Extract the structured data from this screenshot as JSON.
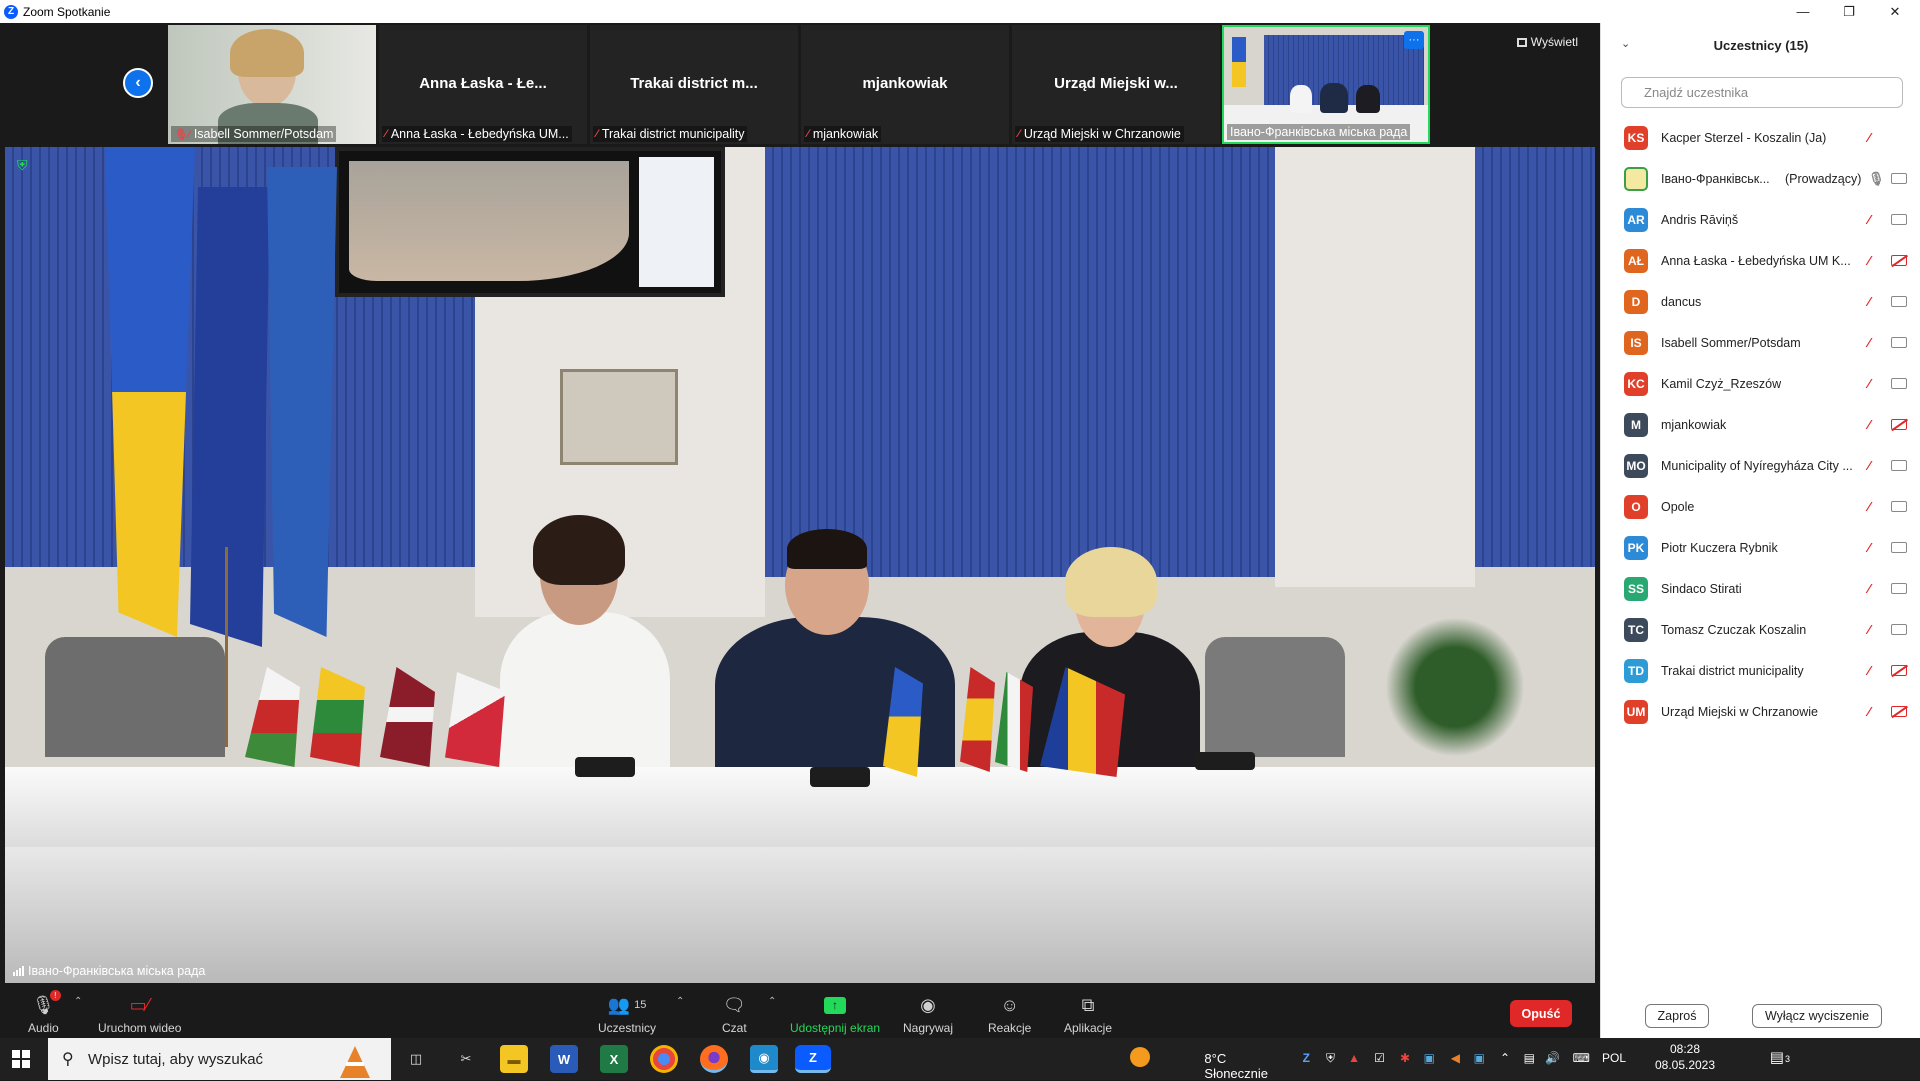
{
  "window": {
    "title": "Zoom Spotkanie"
  },
  "strip": {
    "view_label": "Wyświetl",
    "tiles": [
      {
        "name": "",
        "label": "Isabell Sommer/Potsdam",
        "video": true
      },
      {
        "name": "Anna Łaska - Łe...",
        "label": "Anna Łaska - Łebedyńska UM...",
        "video": false
      },
      {
        "name": "Trakai district m...",
        "label": "Trakai district municipality",
        "video": false
      },
      {
        "name": "mjankowiak",
        "label": "mjankowiak",
        "video": false
      },
      {
        "name": "Urząd Miejski w...",
        "label": "Urząd Miejski w Chrzanowie",
        "video": false
      },
      {
        "name": "",
        "label": "Івано-Франківська міська рада",
        "video": true
      }
    ],
    "more_label": "···"
  },
  "main": {
    "speaker_label": "Івано-Франківська міська рада"
  },
  "toolbar": {
    "audio": "Audio",
    "video": "Uruchom wideo",
    "participants": "Uczestnicy",
    "participants_count": "15",
    "chat": "Czat",
    "share": "Udostępnij ekran",
    "record": "Nagrywaj",
    "reactions": "Reakcje",
    "apps": "Aplikacje",
    "leave": "Opuść",
    "audio_badge": "!"
  },
  "panel": {
    "title": "Uczestnicy (15)",
    "search_placeholder": "Znajdź uczestnika",
    "participants": [
      {
        "initials": "KS",
        "name": "Kacper Sterzel - Koszalin (Ja)",
        "role": "",
        "color": "#e0402a",
        "mic": "off",
        "cam": "none"
      },
      {
        "initials": "",
        "name": "Івано-Франківськ...",
        "role": "(Prowadzący)",
        "color": "#3b9e4a",
        "mic": "on",
        "cam": "on"
      },
      {
        "initials": "AR",
        "name": "Andris Rāviņš",
        "role": "",
        "color": "#2d8ad6",
        "mic": "off",
        "cam": "on"
      },
      {
        "initials": "AŁ",
        "name": "Anna Łaska - Łebedyńska UM K...",
        "role": "",
        "color": "#e0651f",
        "mic": "off",
        "cam": "off"
      },
      {
        "initials": "D",
        "name": "dancus",
        "role": "",
        "color": "#e0651f",
        "mic": "off",
        "cam": "on"
      },
      {
        "initials": "IS",
        "name": "Isabell Sommer/Potsdam",
        "role": "",
        "color": "#e0651f",
        "mic": "off",
        "cam": "on"
      },
      {
        "initials": "KC",
        "name": "Kamil Czyż_Rzeszów",
        "role": "",
        "color": "#e0402a",
        "mic": "off",
        "cam": "on"
      },
      {
        "initials": "M",
        "name": "mjankowiak",
        "role": "",
        "color": "#3d4a5c",
        "mic": "off",
        "cam": "off"
      },
      {
        "initials": "MO",
        "name": "Municipality of Nyíregyháza City ...",
        "role": "",
        "color": "#3d4a5c",
        "mic": "off",
        "cam": "on"
      },
      {
        "initials": "O",
        "name": "Opole",
        "role": "",
        "color": "#e0402a",
        "mic": "off",
        "cam": "on"
      },
      {
        "initials": "PK",
        "name": "Piotr Kuczera Rybnik",
        "role": "",
        "color": "#2d8ad6",
        "mic": "off",
        "cam": "on"
      },
      {
        "initials": "SS",
        "name": "Sindaco Stirati",
        "role": "",
        "color": "#2aa872",
        "mic": "off",
        "cam": "on"
      },
      {
        "initials": "TC",
        "name": "Tomasz Czuczak Koszalin",
        "role": "",
        "color": "#3d4a5c",
        "mic": "off",
        "cam": "on"
      },
      {
        "initials": "TD",
        "name": "Trakai district municipality",
        "role": "",
        "color": "#2d9cd6",
        "mic": "off",
        "cam": "off"
      },
      {
        "initials": "UM",
        "name": "Urząd Miejski w Chrzanowie",
        "role": "",
        "color": "#e0402a",
        "mic": "off",
        "cam": "off"
      }
    ],
    "invite": "Zaproś",
    "mute_all": "Wyłącz wyciszenie"
  },
  "taskbar": {
    "search_placeholder": "Wpisz tutaj, aby wyszukać",
    "weather": "8°C  Słonecznie",
    "lang": "POL",
    "time": "08:28",
    "date": "08.05.2023",
    "notif_count": "3"
  }
}
